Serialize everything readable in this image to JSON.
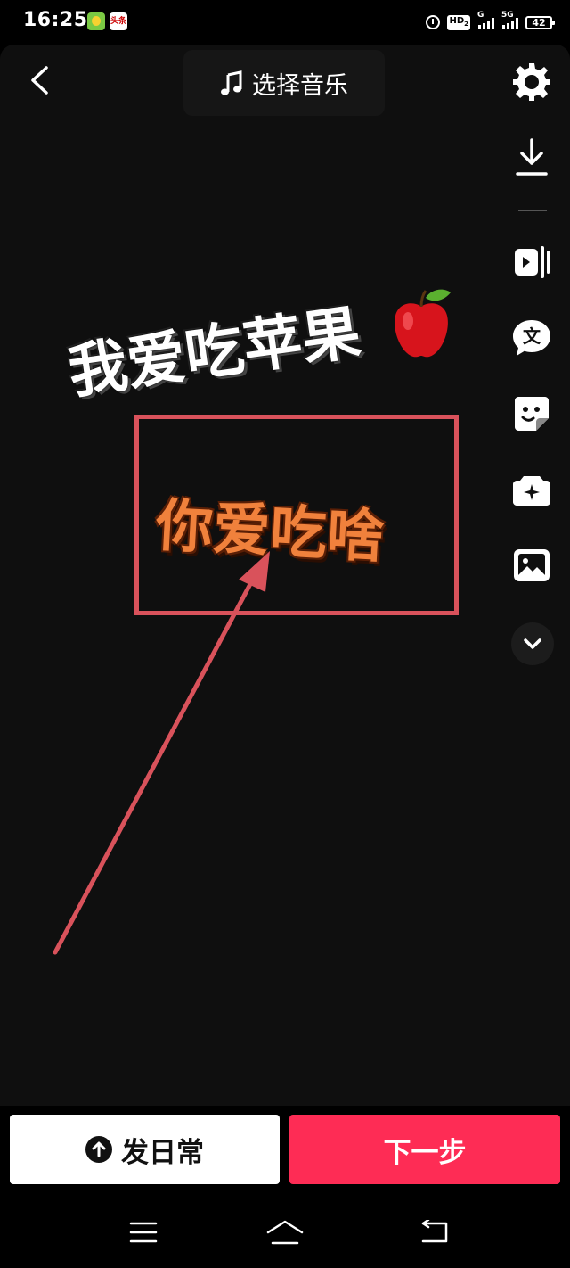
{
  "status_bar": {
    "time": "16:25",
    "toutiao_badge": "头条",
    "hd_badge": "HD",
    "hd_sub": "2",
    "signal1_label": "G",
    "signal2_label": "5G",
    "battery": "42"
  },
  "header": {
    "music_label": "选择音乐"
  },
  "canvas": {
    "sticker_text_1": "我爱吃苹果",
    "sticker_text_2": "你爱吃啥",
    "highlight_color": "#d9525b"
  },
  "toolbar": {
    "icons": [
      "settings-icon",
      "download-icon",
      "split-icon",
      "text-icon",
      "sticker-icon",
      "effects-icon",
      "image-icon",
      "chevron-down-icon"
    ]
  },
  "bottom": {
    "daily_label": "发日常",
    "next_label": "下一步",
    "next_color": "#fe2c55"
  }
}
